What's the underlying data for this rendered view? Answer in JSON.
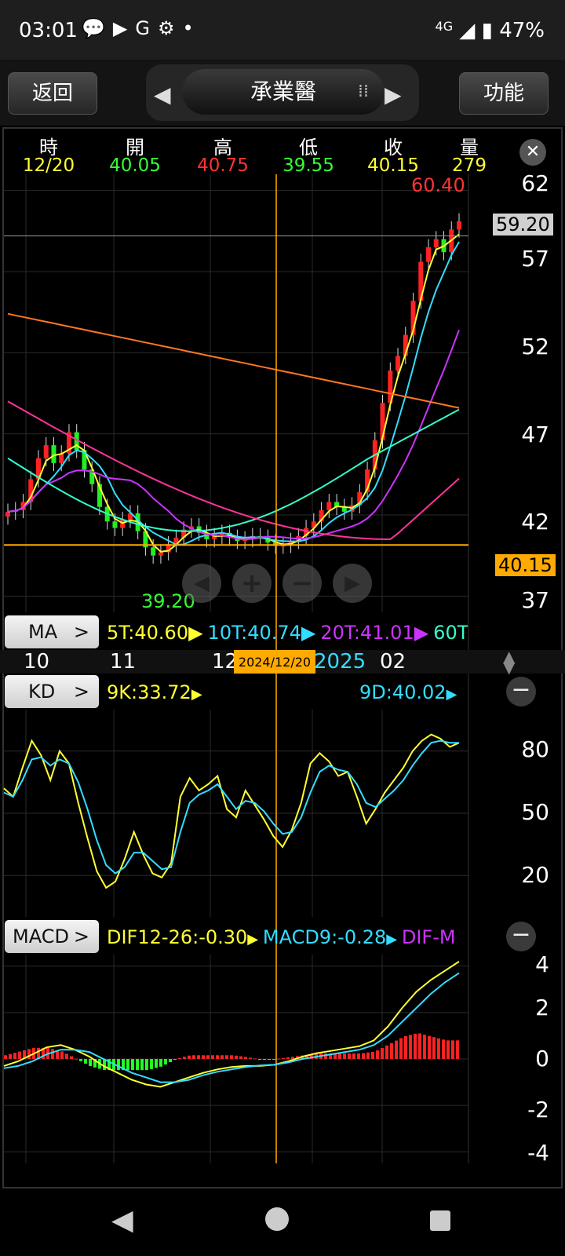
{
  "status_bar": {
    "time": "03:01",
    "network": "4G",
    "battery": "47%",
    "icons": [
      "chat-icon",
      "youtube-icon",
      "google-icon",
      "settings-icon",
      "dot-icon"
    ]
  },
  "top_bar": {
    "back_label": "返回",
    "stock_name": "承業醫",
    "function_label": "功能"
  },
  "quote_header": {
    "labels": [
      "時",
      "開",
      "高",
      "低",
      "收",
      "量"
    ],
    "values": [
      "12/20",
      "40.05",
      "40.75",
      "39.55",
      "40.15",
      "279"
    ],
    "colors": [
      "#ffff33",
      "#33ff33",
      "#ff3333",
      "#33ff33",
      "#ffff33",
      "#ffff33"
    ]
  },
  "price_axis": [
    "62",
    "57",
    "52",
    "47",
    "42",
    "37"
  ],
  "price_tags": {
    "crosshair_price": "59.20",
    "last_close": "40.15",
    "period_high": "60.40",
    "period_low": "39.20"
  },
  "ma_bar": {
    "button": "MA",
    "items": [
      {
        "text": "5T:40.60",
        "color": "#ffff33"
      },
      {
        "text": "10T:40.74",
        "color": "#33ddff"
      },
      {
        "text": "20T:41.01",
        "color": "#cc33ff"
      },
      {
        "text": "60T",
        "color": "#33ffcc"
      }
    ]
  },
  "time_axis": {
    "labels": [
      "10",
      "11",
      "12",
      "2025",
      "02"
    ],
    "cursor_date": "2024/12/20"
  },
  "kd_bar": {
    "button": "KD",
    "k_text": "9K:33.72",
    "d_text": "9D:40.02",
    "axis": [
      "80",
      "50",
      "20"
    ]
  },
  "macd_bar": {
    "button": "MACD",
    "dif_text": "DIF12-26:-0.30",
    "macd_text": "MACD9:-0.28",
    "osc_text": "DIF-M",
    "axis": [
      "4",
      "2",
      "0",
      "-2",
      "-4"
    ]
  },
  "chart_data": [
    {
      "type": "candlestick",
      "title": "",
      "ylim": [
        36,
        63
      ],
      "series": [
        {
          "name": "K",
          "close": [
            42.2,
            42.3,
            42.8,
            44.2,
            45.5,
            46.3,
            45.2,
            45.8,
            47.1,
            46.0,
            44.8,
            43.9,
            42.5,
            41.6,
            41.2,
            41.7,
            42.1,
            41.0,
            40.0,
            39.5,
            39.7,
            40.2,
            40.6,
            41.1,
            41.3,
            40.9,
            40.5,
            40.7,
            40.9,
            40.6,
            40.4,
            40.5,
            40.7,
            40.6,
            40.3,
            40.1,
            40.15,
            40.4,
            40.7,
            41.2,
            41.6,
            42.3,
            42.8,
            42.5,
            42.2,
            42.6,
            43.4,
            44.8,
            46.6,
            48.9,
            50.9,
            51.8,
            53.1,
            55.2,
            57.6,
            58.5,
            59.0,
            58.2,
            59.6,
            60.1
          ]
        }
      ]
    },
    {
      "type": "line",
      "title": "",
      "ylim": [
        0,
        100
      ],
      "series": [
        {
          "name": "9K",
          "values": [
            62,
            58,
            72,
            85,
            78,
            66,
            80,
            74,
            55,
            38,
            22,
            14,
            17,
            28,
            41,
            30,
            21,
            19,
            26,
            58,
            67,
            61,
            64,
            68,
            52,
            48,
            61,
            54,
            47,
            39,
            33.72,
            42,
            55,
            74,
            79,
            75,
            68,
            70,
            58,
            45,
            52,
            60,
            66,
            72,
            80,
            85,
            88,
            86,
            82,
            84
          ]
        },
        {
          "name": "9D",
          "values": [
            60,
            58,
            66,
            76,
            77,
            73,
            76,
            74,
            65,
            52,
            37,
            25,
            21,
            24,
            31,
            31,
            27,
            23,
            24,
            41,
            55,
            59,
            61,
            64,
            58,
            52,
            56,
            55,
            51,
            45,
            40.02,
            41,
            48,
            60,
            70,
            73,
            71,
            70,
            64,
            55,
            53,
            57,
            61,
            66,
            73,
            79,
            84,
            85,
            84,
            84
          ]
        }
      ]
    },
    {
      "type": "line",
      "title": "",
      "ylim": [
        -4.5,
        4.5
      ],
      "series": [
        {
          "name": "DIF12-26",
          "values": [
            -0.3,
            -0.1,
            0.2,
            0.5,
            0.6,
            0.4,
            0.1,
            -0.3,
            -0.6,
            -0.9,
            -1.1,
            -1.2,
            -1.0,
            -0.8,
            -0.6,
            -0.45,
            -0.35,
            -0.3,
            -0.3,
            -0.25,
            -0.1,
            0.1,
            0.25,
            0.35,
            0.45,
            0.55,
            0.8,
            1.4,
            2.2,
            2.9,
            3.4,
            3.8,
            4.2
          ]
        },
        {
          "name": "MACD9",
          "values": [
            -0.4,
            -0.3,
            -0.1,
            0.2,
            0.4,
            0.4,
            0.3,
            0.0,
            -0.3,
            -0.6,
            -0.8,
            -1.0,
            -1.0,
            -0.9,
            -0.7,
            -0.55,
            -0.45,
            -0.35,
            -0.28,
            -0.25,
            -0.15,
            0.0,
            0.1,
            0.2,
            0.3,
            0.4,
            0.6,
            1.0,
            1.6,
            2.2,
            2.8,
            3.3,
            3.7
          ]
        }
      ]
    }
  ]
}
